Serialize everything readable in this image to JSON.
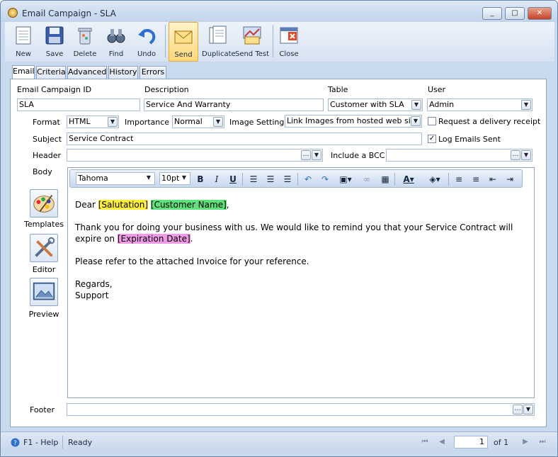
{
  "window": {
    "title": "Email Campaign - SLA",
    "min": "_",
    "max": "□",
    "close": "✕"
  },
  "toolbar": {
    "new": "New",
    "save": "Save",
    "delete": "Delete",
    "find": "Find",
    "undo": "Undo",
    "send": "Send",
    "duplicate": "Duplicate",
    "send_test": "Send Test",
    "close": "Close"
  },
  "tabs": [
    "Email",
    "Criteria",
    "Advanced",
    "History",
    "Errors"
  ],
  "form": {
    "campaign_id_label": "Email Campaign ID",
    "campaign_id_value": "SLA",
    "description_label": "Description",
    "description_value": "Service And Warranty",
    "table_label": "Table",
    "table_value": "Customer with SLA",
    "user_label": "User",
    "user_value": "Admin",
    "format_label": "Format",
    "format_value": "HTML",
    "importance_label": "Importance",
    "importance_value": "Normal",
    "image_setting_label": "Image Setting",
    "image_setting_value": "Link Images from hosted web site",
    "request_receipt_label": "Request a delivery receipt",
    "request_receipt_checked": false,
    "subject_label": "Subject",
    "subject_value": "Service Contract",
    "log_emails_label": "Log Emails Sent",
    "log_emails_checked": true,
    "header_label": "Header",
    "header_value": "",
    "include_bcc_label": "Include a BCC",
    "include_bcc_value": "",
    "body_label": "Body",
    "footer_label": "Footer",
    "footer_value": ""
  },
  "side": {
    "templates": "Templates",
    "editor": "Editor",
    "preview": "Preview"
  },
  "editor_toolbar": {
    "font": "Tahoma",
    "size": "10pt",
    "bold": "B",
    "italic": "I",
    "underline": "U"
  },
  "body": {
    "dear": "Dear ",
    "salutation": "[Salutation]",
    "space": " ",
    "customer_name": "[Customer Name]",
    "comma": ",",
    "line2": "Thank you for doing your business with us. We would like to remind you that your Service Contract will",
    "line3_pre": "expire on ",
    "expiration": "[Expiration Date]",
    "line3_post": ".",
    "line4": "Please refer to the attached Invoice for your reference.",
    "regards": "Regards,",
    "support": "Support"
  },
  "status": {
    "help": "F1 - Help",
    "state": "Ready",
    "page": "1",
    "of": "of 1"
  },
  "colors": {
    "accent": "#c9d9ee",
    "highlight_yellow": "#ffee3a",
    "highlight_green": "#5ee07a",
    "highlight_pink": "#ef9be6"
  }
}
